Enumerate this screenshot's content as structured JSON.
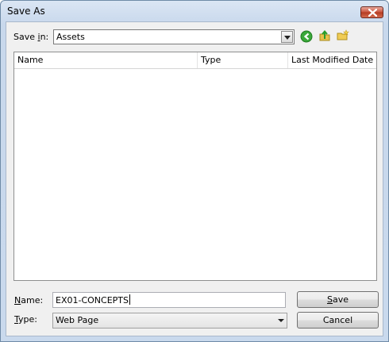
{
  "window": {
    "title": "Save As"
  },
  "save_in": {
    "label_pre": "Save ",
    "label_u": "i",
    "label_post": "n:",
    "value": "Assets"
  },
  "toolbar": {
    "back_icon": "back-arrow-icon",
    "up_icon": "up-folder-icon",
    "new_folder_icon": "new-folder-icon"
  },
  "file_list": {
    "columns": [
      "Name",
      "Type",
      "Last Modified Date"
    ],
    "rows": []
  },
  "name_field": {
    "label_u": "N",
    "label_post": "ame:",
    "value": "EX01-CONCEPTS"
  },
  "type_field": {
    "label_u": "T",
    "label_post": "ype:",
    "value": "Web Page"
  },
  "buttons": {
    "save_u": "S",
    "save_post": "ave",
    "cancel": "Cancel"
  },
  "colors": {
    "close_button": "#c9523b",
    "window_frame": "#c9d9ed",
    "accent_green": "#2a9d2a"
  }
}
